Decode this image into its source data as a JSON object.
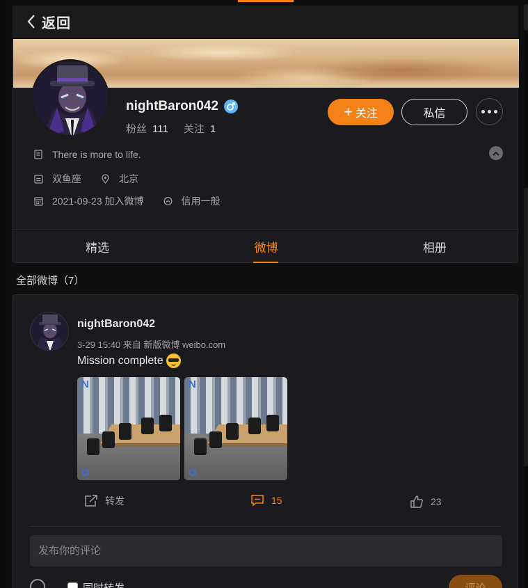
{
  "header": {
    "back_label": "返回"
  },
  "profile": {
    "username": "nightBaron042",
    "stats": [
      {
        "label": "粉丝",
        "value": "111"
      },
      {
        "label": "关注",
        "value": "1"
      }
    ],
    "follow_label": "关注",
    "follow_plus": "+",
    "message_label": "私信",
    "bio": "There is more to life.",
    "zodiac": "双鱼座",
    "location": "北京",
    "joined": "2021-09-23 加入微博",
    "credit": "信用一般"
  },
  "tabs": [
    {
      "label": "精选",
      "active": false
    },
    {
      "label": "微博",
      "active": true
    },
    {
      "label": "相册",
      "active": false
    }
  ],
  "feed": {
    "section_title": "全部微博（7）"
  },
  "post": {
    "user": "nightBaron042",
    "meta": "3-29 15:40 来自 新版微博 weibo.com",
    "text": "Mission complete",
    "watermark_top": "N",
    "watermark_bottom": "O",
    "repost_label": "转发",
    "comment_count": "15",
    "like_count": "23"
  },
  "comment_box": {
    "placeholder": "发布你的评论",
    "also_repost_label": "同时转发",
    "submit_label": "评论"
  },
  "colors": {
    "accent": "#ff8200",
    "follow_bg": "#f28216",
    "card_bg": "#1b1b1f",
    "verified_blue": "#5fb6f7"
  }
}
